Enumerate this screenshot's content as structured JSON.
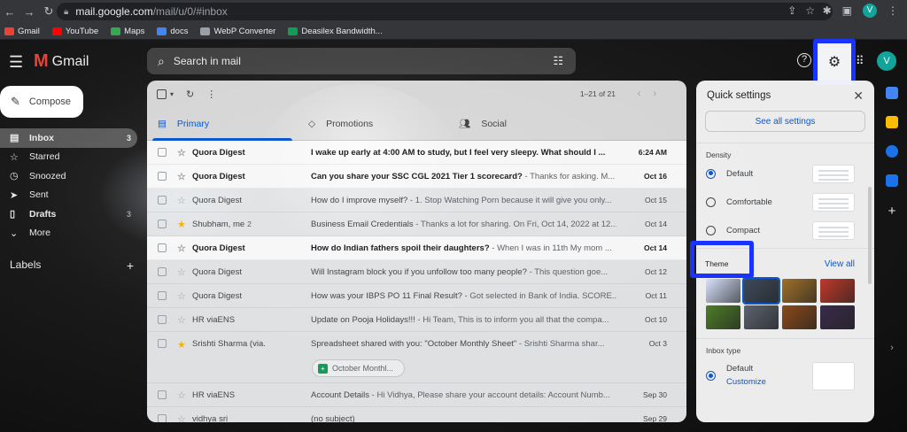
{
  "browser": {
    "url_host": "mail.google.com",
    "url_path": "/mail/u/0/#inbox",
    "profile_initial": "V",
    "bookmarks": [
      {
        "label": "Gmail",
        "color": "#ea4335"
      },
      {
        "label": "YouTube",
        "color": "#ff0000"
      },
      {
        "label": "Maps",
        "color": "#34a853"
      },
      {
        "label": "docs",
        "color": "#4285f4"
      },
      {
        "label": "WebP Converter",
        "color": "#9aa0a6"
      },
      {
        "label": "Deasilex Bandwidth...",
        "color": "#0f9d58"
      }
    ]
  },
  "header": {
    "app_name": "Gmail",
    "search_placeholder": "Search in mail",
    "avatar_initial": "V"
  },
  "sidebar": {
    "compose": "Compose",
    "items": [
      {
        "label": "Inbox",
        "count": "3",
        "icon": "inbox-icon"
      },
      {
        "label": "Starred",
        "count": "",
        "icon": "star-icon"
      },
      {
        "label": "Snoozed",
        "count": "",
        "icon": "clock-icon"
      },
      {
        "label": "Sent",
        "count": "",
        "icon": "send-icon"
      },
      {
        "label": "Drafts",
        "count": "3",
        "icon": "draft-icon"
      },
      {
        "label": "More",
        "count": "",
        "icon": "chevron-down-icon"
      }
    ],
    "labels_title": "Labels"
  },
  "mail": {
    "pagination": "1–21 of 21",
    "tabs": [
      {
        "label": "Primary",
        "icon": "inbox-icon"
      },
      {
        "label": "Promotions",
        "icon": "tag-icon"
      },
      {
        "label": "Social",
        "icon": "people-icon"
      }
    ],
    "rows": [
      {
        "sender": "Quora Digest",
        "count": "",
        "subject": "I wake up early at 4:00 AM to study, but I feel very sleepy. What should I ...",
        "snippet": "",
        "date": "6:24 AM",
        "unread": true,
        "starred": false
      },
      {
        "sender": "Quora Digest",
        "count": "",
        "subject": "Can you share your SSC CGL 2021 Tier 1 scorecard?",
        "snippet": " - Thanks for asking. M...",
        "date": "Oct 16",
        "unread": true,
        "starred": false
      },
      {
        "sender": "Quora Digest",
        "count": "",
        "subject": "How do I improve myself?",
        "snippet": " - 1. Stop Watching Porn because it will give you only...",
        "date": "Oct 15",
        "unread": false,
        "starred": false
      },
      {
        "sender": "Shubham, me",
        "count": "2",
        "subject": "Business Email Credentials",
        "snippet": " - Thanks a lot for sharing. On Fri, Oct 14, 2022 at 12...",
        "date": "Oct 14",
        "unread": false,
        "starred": true
      },
      {
        "sender": "Quora Digest",
        "count": "",
        "subject": "How do Indian fathers spoil their daughters?",
        "snippet": " - When I was in 11th My mom ...",
        "date": "Oct 14",
        "unread": true,
        "starred": false
      },
      {
        "sender": "Quora Digest",
        "count": "",
        "subject": "Will Instagram block you if you unfollow too many people?",
        "snippet": " - This question goe...",
        "date": "Oct 12",
        "unread": false,
        "starred": false
      },
      {
        "sender": "Quora Digest",
        "count": "",
        "subject": "How was your IBPS PO 11 Final Result?",
        "snippet": " - Got selected in Bank of India. SCORE...",
        "date": "Oct 11",
        "unread": false,
        "starred": false
      },
      {
        "sender": "HR viaENS",
        "count": "",
        "subject": "Update on Pooja Holidays!!!",
        "snippet": " - Hi Team, This is to inform you all that the compa...",
        "date": "Oct 10",
        "unread": false,
        "starred": false
      },
      {
        "sender": "Srishti Sharma (via.",
        "count": "",
        "subject": "Spreadsheet shared with you: \"October Monthly Sheet\"",
        "snippet": " - Srishti Sharma shar...",
        "date": "Oct 3",
        "unread": false,
        "starred": true,
        "attachment": "October Monthl..."
      },
      {
        "sender": "HR viaENS",
        "count": "",
        "subject": "Account Details",
        "snippet": " - Hi Vidhya, Please share your account details: Account Numb...",
        "date": "Sep 30",
        "unread": false,
        "starred": false
      },
      {
        "sender": "vidhya sri",
        "count": "",
        "subject": "(no subject)",
        "snippet": "",
        "date": "Sep 29",
        "unread": false,
        "starred": false
      }
    ]
  },
  "quick_settings": {
    "title": "Quick settings",
    "see_all": "See all settings",
    "density_title": "Density",
    "density": [
      {
        "label": "Default",
        "selected": true
      },
      {
        "label": "Comfortable",
        "selected": false
      },
      {
        "label": "Compact",
        "selected": false
      }
    ],
    "theme_title": "Theme",
    "view_all": "View all",
    "theme_colors": [
      "#d7e3fc",
      "#3d4a5c",
      "#a0702a",
      "#c0392b",
      "#4e7d28",
      "#5c6470",
      "#8a4a1a",
      "#3a2a4a"
    ],
    "inbox_type_title": "Inbox type",
    "inbox_default": "Default",
    "inbox_customize": "Customize"
  },
  "colors": {
    "highlight": "#1a33ff",
    "accent": "#0b57d0"
  }
}
